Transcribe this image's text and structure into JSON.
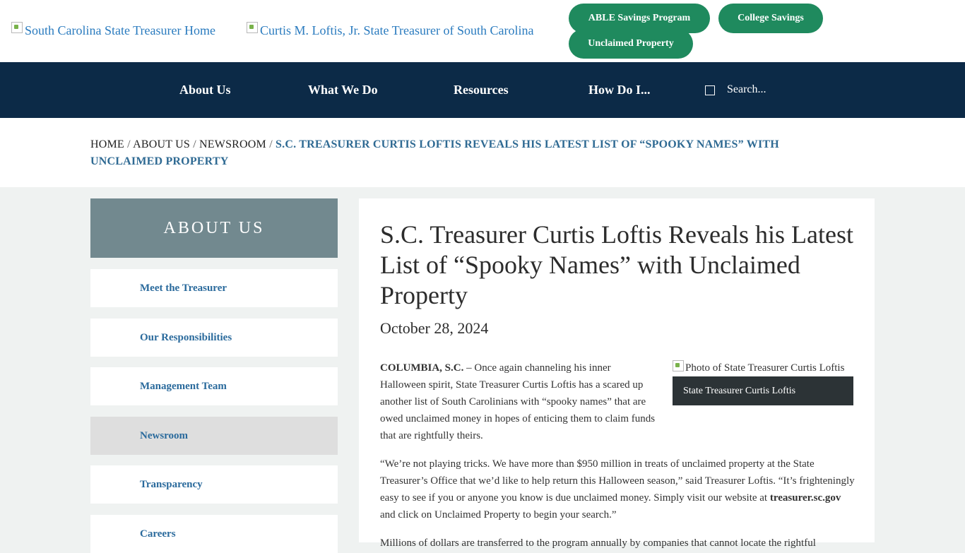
{
  "header": {
    "logo_alt": "South Carolina State Treasurer Home",
    "treasurer_alt": "Curtis M. Loftis, Jr. State Treasurer of South Carolina",
    "buttons": [
      "ABLE Savings Program",
      "College Savings",
      "Unclaimed Property"
    ]
  },
  "nav": {
    "items": [
      "About Us",
      "What We Do",
      "Resources",
      "How Do I..."
    ],
    "search_placeholder": "Search..."
  },
  "breadcrumb": {
    "items": [
      "HOME",
      "ABOUT US",
      "NEWSROOM"
    ],
    "separator": "/",
    "current": "S.C. TREASURER CURTIS LOFTIS REVEALS HIS LATEST LIST OF “SPOOKY NAMES” WITH UNCLAIMED PROPERTY"
  },
  "sidebar": {
    "heading": "ABOUT US",
    "items": [
      "Meet the Treasurer",
      "Our Responsibilities",
      "Management Team",
      "Newsroom",
      "Transparency",
      "Careers"
    ],
    "active": "Newsroom"
  },
  "article": {
    "title": "S.C. Treasurer Curtis Loftis Reveals his Latest List of “Spooky Names” with Unclaimed Property",
    "date": "October 28, 2024",
    "dateline": "COLUMBIA, S.C.",
    "p1_rest": "  – Once again channeling his inner Halloween spirit, State Treasurer Curtis Loftis has a scared up another list of South Carolinians with “spooky names” that are owed unclaimed money in hopes of enticing them to claim funds that are rightfully theirs.",
    "p2_start": "“We’re not playing tricks. We have more than $950 million in treats of unclaimed property at the State Treasurer’s Office that we’d like to help return this Halloween season,” said Treasurer Loftis. “It’s frighteningly easy to see if you or anyone you know is due unclaimed money. Simply visit our website at ",
    "p2_link": "treasurer.sc.gov",
    "p2_end": " and click on Unclaimed Property to begin your search.”",
    "p3": "Millions of dollars are transferred to the program annually by companies that cannot locate the rightful",
    "photo_alt": "Photo of State Treasurer Curtis Loftis",
    "photo_caption": "State Treasurer Curtis Loftis"
  }
}
